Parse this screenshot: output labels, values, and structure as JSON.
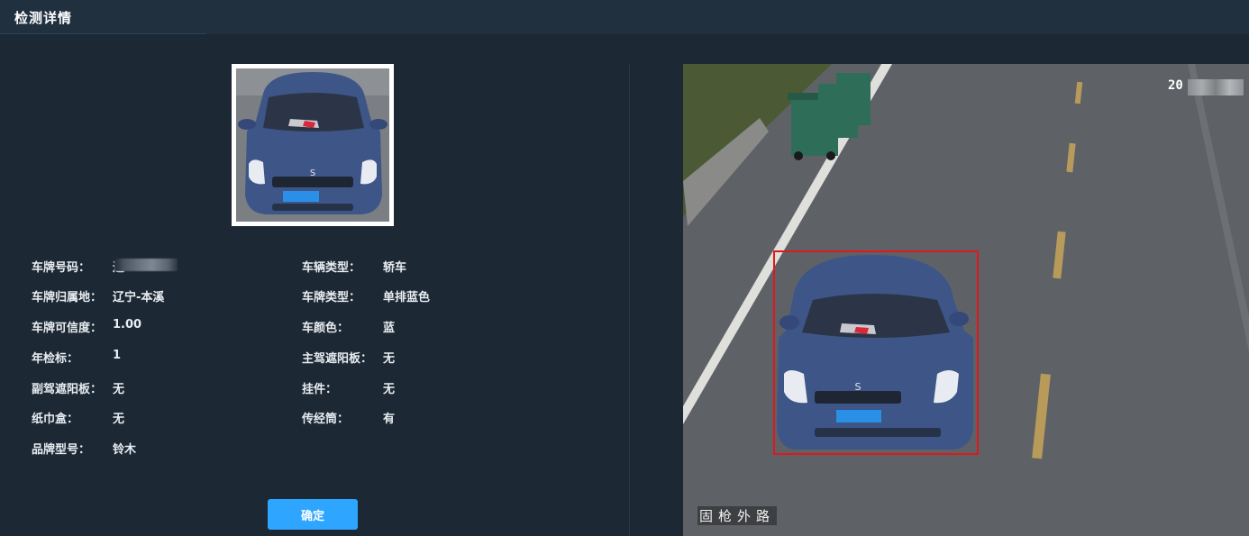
{
  "window": {
    "title": "检测详情"
  },
  "left_fields": [
    {
      "label": "车牌号码：",
      "value": "辽",
      "redacted": true
    },
    {
      "label": "车牌归属地：",
      "value": "辽宁-本溪"
    },
    {
      "label": "车牌可信度：",
      "value": "1.00"
    },
    {
      "label": "年检标：",
      "value": "1"
    },
    {
      "label": "副驾遮阳板：",
      "value": "无"
    },
    {
      "label": "纸巾盒：",
      "value": "无"
    },
    {
      "label": "品牌型号：",
      "value": "铃木"
    }
  ],
  "right_fields": [
    {
      "label": "车辆类型：",
      "value": "轿车"
    },
    {
      "label": "车牌类型：",
      "value": "单排蓝色"
    },
    {
      "label": "车颜色：",
      "value": "蓝"
    },
    {
      "label": "主驾遮阳板：",
      "value": "无"
    },
    {
      "label": "挂件：",
      "value": "无"
    },
    {
      "label": "传经筒：",
      "value": "有"
    }
  ],
  "confirm_button": "确定",
  "scene": {
    "caption": "固枪外路",
    "timestamp_prefix": "20"
  },
  "colors": {
    "background": "#1c2833",
    "titlebar": "#20303f",
    "button": "#2ea6ff",
    "detection_box": "#e0181b",
    "car_body": "#3e5588"
  }
}
